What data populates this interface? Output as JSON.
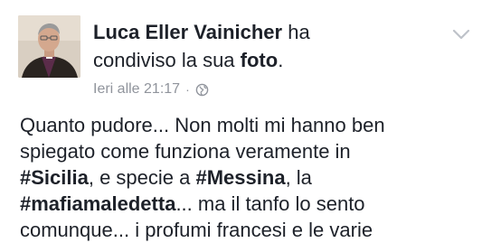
{
  "post": {
    "author_name": "Luca Eller Vainicher",
    "action_1": " ha",
    "action_2": "condiviso la sua ",
    "object": "foto",
    "object_suffix": ".",
    "timestamp": "Ieri alle 21:17",
    "separator": "·",
    "privacy_icon": "globe-icon",
    "menu_icon": "chevron-down-icon",
    "body": {
      "line1": "Quanto pudore... Non molti mi hanno ben",
      "line2": "spiegato come funziona veramente in",
      "line3_prefix": "#",
      "line3_tag1": "Sicilia",
      "line3_mid": ", e specie a ",
      "line3_hash2": "#",
      "line3_tag2": "Messina",
      "line3_suffix": ", la",
      "line4_hash": "#",
      "line4_tag": "mafiamaledetta",
      "line4_suffix": "... ma il tanfo lo sento",
      "line5": "comunque... i profumi francesi e le varie"
    }
  },
  "colors": {
    "text": "#1d2129",
    "meta": "#90949c",
    "chevron": "#bec2c9"
  }
}
